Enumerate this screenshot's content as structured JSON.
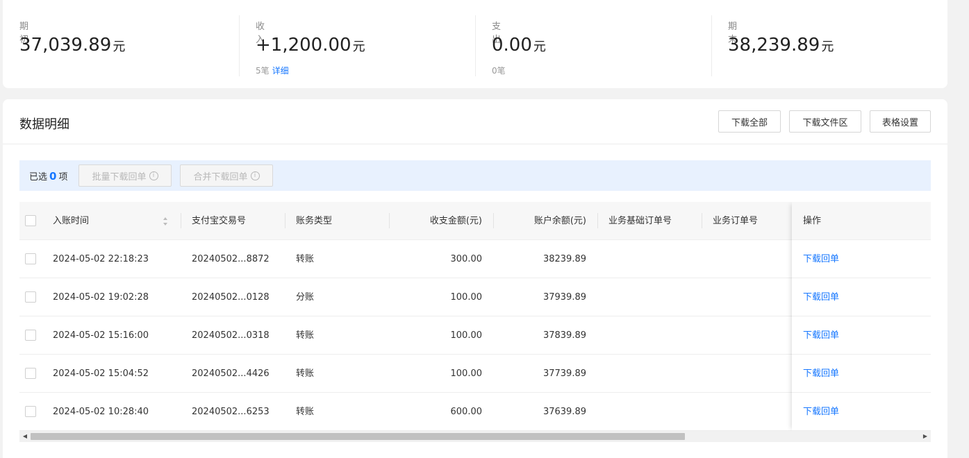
{
  "summary": {
    "opening": {
      "label": "期初",
      "amount": "37,039.89",
      "unit": "元"
    },
    "income": {
      "label": "收入",
      "amount": "+1,200.00",
      "unit": "元",
      "count": "5笔",
      "detail_link": "详细"
    },
    "expense": {
      "label": "支出",
      "amount": "0.00",
      "unit": "元",
      "count": "0笔"
    },
    "closing": {
      "label": "期末",
      "amount": "38,239.89",
      "unit": "元"
    }
  },
  "detail": {
    "title": "数据明细",
    "buttons": {
      "download_all": "下载全部",
      "download_area": "下载文件区",
      "table_settings": "表格设置"
    }
  },
  "selection": {
    "prefix": "已选",
    "count": "0",
    "suffix": "项",
    "batch_download": "批量下载回单",
    "merge_download": "合并下载回单"
  },
  "table": {
    "columns": {
      "time": "入账时间",
      "trade_no": "支付宝交易号",
      "type": "账务类型",
      "amount": "收支金额(元)",
      "balance": "账户余额(元)",
      "base_order": "业务基础订单号",
      "order": "业务订单号",
      "action": "操作"
    },
    "rows": [
      {
        "time": "2024-05-02 22:18:23",
        "trade_no": "20240502...8872",
        "type": "转账",
        "amount": "300.00",
        "balance": "38239.89",
        "base_order": "",
        "order": "",
        "action": "下载回单"
      },
      {
        "time": "2024-05-02 19:02:28",
        "trade_no": "20240502...0128",
        "type": "分账",
        "amount": "100.00",
        "balance": "37939.89",
        "base_order": "",
        "order": "",
        "action": "下载回单"
      },
      {
        "time": "2024-05-02 15:16:00",
        "trade_no": "20240502...0318",
        "type": "转账",
        "amount": "100.00",
        "balance": "37839.89",
        "base_order": "",
        "order": "",
        "action": "下载回单"
      },
      {
        "time": "2024-05-02 15:04:52",
        "trade_no": "20240502...4426",
        "type": "转账",
        "amount": "100.00",
        "balance": "37739.89",
        "base_order": "",
        "order": "",
        "action": "下载回单"
      },
      {
        "time": "2024-05-02 10:28:40",
        "trade_no": "20240502...6253",
        "type": "转账",
        "amount": "600.00",
        "balance": "37639.89",
        "base_order": "",
        "order": "",
        "action": "下载回单"
      }
    ]
  },
  "icons": {
    "sort": "sort-icon",
    "info": "info-icon",
    "checkbox": "checkbox-icon"
  },
  "colors": {
    "accent": "#1677ff",
    "selection_bg": "#e8f1fe"
  }
}
